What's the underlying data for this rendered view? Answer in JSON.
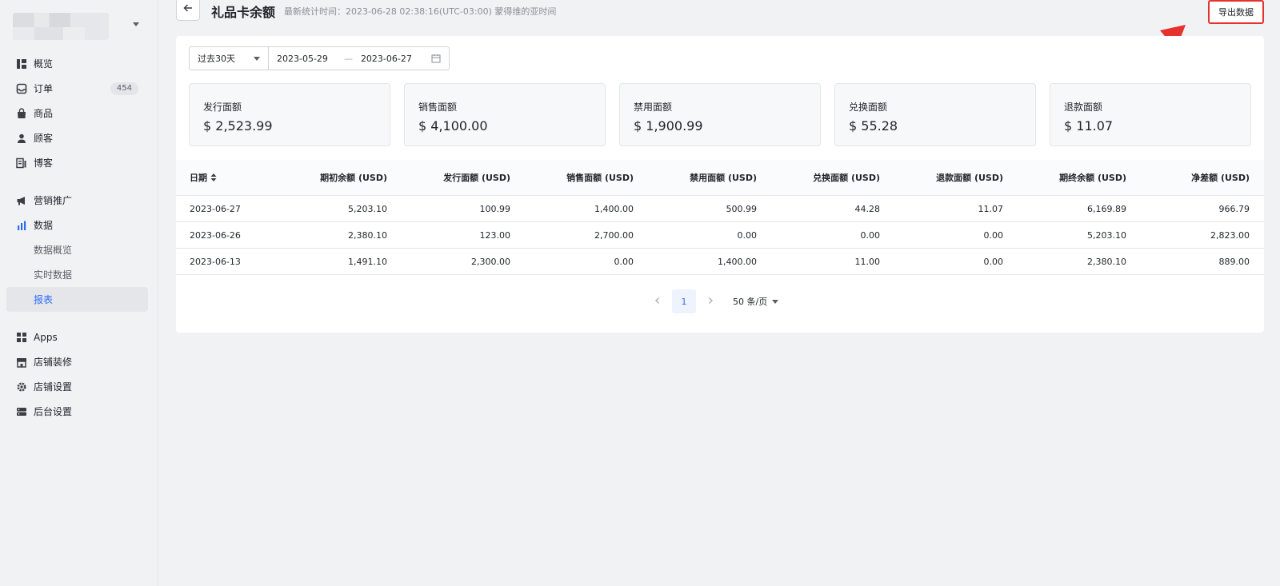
{
  "sidebar": {
    "items": [
      {
        "label": "概览",
        "icon": "dashboard-icon"
      },
      {
        "label": "订单",
        "icon": "inbox-icon",
        "badge": "454"
      },
      {
        "label": "商品",
        "icon": "bag-icon"
      },
      {
        "label": "顾客",
        "icon": "person-icon"
      },
      {
        "label": "博客",
        "icon": "blog-icon"
      },
      {
        "label": "营销推广",
        "icon": "megaphone-icon"
      },
      {
        "label": "数据",
        "icon": "bar-chart-icon"
      },
      {
        "label": "数据概览"
      },
      {
        "label": "实时数据"
      },
      {
        "label": "报表"
      },
      {
        "label": "Apps",
        "icon": "apps-icon"
      },
      {
        "label": "店铺装修",
        "icon": "store-icon"
      },
      {
        "label": "店铺设置",
        "icon": "gear-icon"
      },
      {
        "label": "后台设置",
        "icon": "server-icon"
      }
    ]
  },
  "header": {
    "title": "礼品卡余额",
    "update_time": "最新统计时间：2023-06-28 02:38:16(UTC-03:00) 蒙得维的亚时间",
    "export_label": "导出数据"
  },
  "filter": {
    "range": "过去30天",
    "start_date": "2023-05-29",
    "separator": "—",
    "end_date": "2023-06-27"
  },
  "cards": [
    {
      "label": "发行面额",
      "value": "$ 2,523.99"
    },
    {
      "label": "销售面额",
      "value": "$ 4,100.00"
    },
    {
      "label": "禁用面额",
      "value": "$ 1,900.99"
    },
    {
      "label": "兑换面额",
      "value": "$ 55.28"
    },
    {
      "label": "退款面额",
      "value": "$ 11.07"
    }
  ],
  "table": {
    "headers": [
      "日期",
      "期初余额 (USD)",
      "发行面额 (USD)",
      "销售面额 (USD)",
      "禁用面额 (USD)",
      "兑换面额 (USD)",
      "退款面额 (USD)",
      "期终余额 (USD)",
      "净差额 (USD)"
    ],
    "rows": [
      [
        "2023-06-27",
        "5,203.10",
        "100.99",
        "1,400.00",
        "500.99",
        "44.28",
        "11.07",
        "6,169.89",
        "966.79"
      ],
      [
        "2023-06-26",
        "2,380.10",
        "123.00",
        "2,700.00",
        "0.00",
        "0.00",
        "0.00",
        "5,203.10",
        "2,823.00"
      ],
      [
        "2023-06-13",
        "1,491.10",
        "2,300.00",
        "0.00",
        "1,400.00",
        "11.00",
        "0.00",
        "2,380.10",
        "889.00"
      ]
    ]
  },
  "pagination": {
    "current": "1",
    "page_size": "50 条/页"
  },
  "colors": {
    "accent": "#2d6df6",
    "annotation": "#e5322d"
  }
}
